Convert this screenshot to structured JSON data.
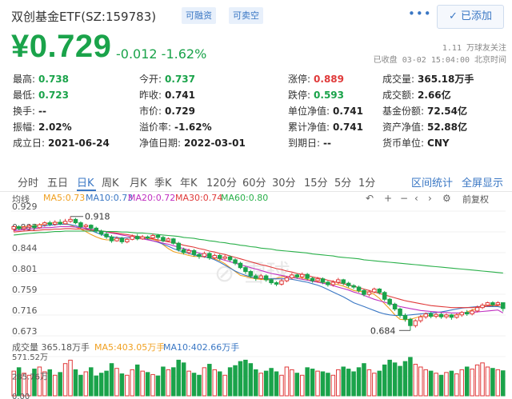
{
  "header": {
    "title": "双创基金ETF(SZ:159783)",
    "badge_margin": "可融资",
    "badge_short": "可卖空",
    "more_icon": "more-dots-icon",
    "added_label": "✓ 已添加"
  },
  "quote": {
    "price": "¥0.729",
    "change": "-0.012 -1.62%",
    "followers": "1.11 万球友关注",
    "status": "已收盘 03-02 15:04:00 北京时间"
  },
  "stats": [
    {
      "label": "最高:",
      "value": "0.738",
      "color": "#1aa34a"
    },
    {
      "label": "今开:",
      "value": "0.737",
      "color": "#1aa34a"
    },
    {
      "label": "涨停:",
      "value": "0.889",
      "color": "#e03a3a"
    },
    {
      "label": "成交量:",
      "value": "365.18万手",
      "color": "#222"
    },
    {
      "label": "最低:",
      "value": "0.723",
      "color": "#1aa34a"
    },
    {
      "label": "昨收:",
      "value": "0.741",
      "color": "#222"
    },
    {
      "label": "跌停:",
      "value": "0.593",
      "color": "#1aa34a"
    },
    {
      "label": "成交额:",
      "value": "2.66亿",
      "color": "#222"
    },
    {
      "label": "换手:",
      "value": "--",
      "color": "#222"
    },
    {
      "label": "市价:",
      "value": "0.729",
      "color": "#222"
    },
    {
      "label": "单位净值:",
      "value": "0.741",
      "color": "#222"
    },
    {
      "label": "基金份额:",
      "value": "72.54亿",
      "color": "#222"
    },
    {
      "label": "振幅:",
      "value": "2.02%",
      "color": "#222"
    },
    {
      "label": "溢价率:",
      "value": "-1.62%",
      "color": "#222"
    },
    {
      "label": "累计净值:",
      "value": "0.741",
      "color": "#222"
    },
    {
      "label": "资产净值:",
      "value": "52.88亿",
      "color": "#222"
    },
    {
      "label": "成立日:",
      "value": "2021-06-24",
      "color": "#222"
    },
    {
      "label": "净值日期:",
      "value": "2022-03-01",
      "color": "#222"
    },
    {
      "label": "到期日:",
      "value": "--",
      "color": "#222"
    },
    {
      "label": "货币单位:",
      "value": "CNY",
      "color": "#222"
    }
  ],
  "tabs": [
    "分时",
    "五日",
    "日K",
    "周K",
    "月K",
    "季K",
    "年K",
    "120分",
    "60分",
    "30分",
    "15分",
    "5分",
    "1分"
  ],
  "active_tab": "日K",
  "tab_links": [
    "区间统计",
    "全屏显示"
  ],
  "chart_controls": {
    "left_label": "均线",
    "adjust_label": "前复权",
    "icons": [
      "undo-icon",
      "zoom-in-icon",
      "zoom-out-icon",
      "move-left-icon",
      "move-right-icon",
      "settings-icon"
    ]
  },
  "ma_legend": [
    {
      "label": "MA5:0.73",
      "color": "#f0a020"
    },
    {
      "label": "MA10:0.73",
      "color": "#3a77c4"
    },
    {
      "label": "MA20:0.72",
      "color": "#c030c0"
    },
    {
      "label": "MA30:0.74",
      "color": "#e03a3a"
    },
    {
      "label": "MA60:0.80",
      "color": "#2ab04a"
    }
  ],
  "volume_legend": [
    {
      "label": "成交量 365.18万手",
      "color": "#555"
    },
    {
      "label": "MA5:403.05万手",
      "color": "#f0a020"
    },
    {
      "label": "MA10:402.66万手",
      "color": "#3a77c4"
    }
  ],
  "colors": {
    "up": "#e03a3a",
    "down": "#1aa34a",
    "accent": "#3a77c4"
  },
  "chart_data": {
    "type": "candlestick",
    "y_ticks": [
      "0.929",
      "0.887",
      "0.844",
      "0.801",
      "0.759",
      "0.716",
      "0.673"
    ],
    "ylim": [
      0.673,
      0.929
    ],
    "annotations": {
      "high": "0.918",
      "low": "0.684"
    },
    "volume_ticks": [
      "571.52万",
      "285.76万",
      "0.00"
    ],
    "volume_ylim": [
      0,
      571.52
    ],
    "candles": [
      [
        0.892,
        0.897,
        0.887,
        0.899
      ],
      [
        0.897,
        0.893,
        0.89,
        0.9
      ],
      [
        0.893,
        0.896,
        0.889,
        0.899
      ],
      [
        0.896,
        0.899,
        0.892,
        0.902
      ],
      [
        0.899,
        0.895,
        0.891,
        0.903
      ],
      [
        0.895,
        0.901,
        0.893,
        0.904
      ],
      [
        0.901,
        0.905,
        0.897,
        0.908
      ],
      [
        0.905,
        0.902,
        0.898,
        0.909
      ],
      [
        0.902,
        0.906,
        0.899,
        0.91
      ],
      [
        0.906,
        0.903,
        0.9,
        0.912
      ],
      [
        0.903,
        0.908,
        0.901,
        0.913
      ],
      [
        0.908,
        0.912,
        0.905,
        0.918
      ],
      [
        0.912,
        0.905,
        0.902,
        0.915
      ],
      [
        0.905,
        0.897,
        0.893,
        0.908
      ],
      [
        0.897,
        0.9,
        0.893,
        0.903
      ],
      [
        0.9,
        0.894,
        0.889,
        0.902
      ],
      [
        0.894,
        0.888,
        0.884,
        0.897
      ],
      [
        0.888,
        0.882,
        0.878,
        0.891
      ],
      [
        0.882,
        0.876,
        0.872,
        0.886
      ],
      [
        0.876,
        0.868,
        0.864,
        0.88
      ],
      [
        0.868,
        0.873,
        0.866,
        0.877
      ],
      [
        0.873,
        0.866,
        0.862,
        0.876
      ],
      [
        0.866,
        0.871,
        0.863,
        0.874
      ],
      [
        0.871,
        0.877,
        0.869,
        0.881
      ],
      [
        0.877,
        0.872,
        0.869,
        0.882
      ],
      [
        0.872,
        0.876,
        0.87,
        0.88
      ],
      [
        0.876,
        0.874,
        0.871,
        0.879
      ],
      [
        0.874,
        0.879,
        0.872,
        0.883
      ],
      [
        0.879,
        0.875,
        0.871,
        0.882
      ],
      [
        0.875,
        0.868,
        0.865,
        0.878
      ],
      [
        0.868,
        0.872,
        0.865,
        0.875
      ],
      [
        0.872,
        0.863,
        0.86,
        0.874
      ],
      [
        0.863,
        0.85,
        0.846,
        0.866
      ],
      [
        0.85,
        0.844,
        0.84,
        0.854
      ],
      [
        0.844,
        0.848,
        0.84,
        0.852
      ],
      [
        0.848,
        0.84,
        0.836,
        0.851
      ],
      [
        0.84,
        0.836,
        0.831,
        0.843
      ],
      [
        0.836,
        0.842,
        0.833,
        0.846
      ],
      [
        0.842,
        0.833,
        0.829,
        0.845
      ],
      [
        0.833,
        0.838,
        0.83,
        0.842
      ],
      [
        0.838,
        0.832,
        0.828,
        0.841
      ],
      [
        0.832,
        0.835,
        0.828,
        0.839
      ],
      [
        0.835,
        0.829,
        0.825,
        0.838
      ],
      [
        0.829,
        0.822,
        0.818,
        0.832
      ],
      [
        0.822,
        0.813,
        0.81,
        0.825
      ],
      [
        0.813,
        0.805,
        0.8,
        0.816
      ],
      [
        0.805,
        0.796,
        0.792,
        0.808
      ],
      [
        0.796,
        0.791,
        0.786,
        0.8
      ],
      [
        0.791,
        0.796,
        0.788,
        0.8
      ],
      [
        0.796,
        0.788,
        0.784,
        0.799
      ],
      [
        0.788,
        0.782,
        0.778,
        0.791
      ],
      [
        0.782,
        0.779,
        0.775,
        0.785
      ],
      [
        0.779,
        0.786,
        0.776,
        0.79
      ],
      [
        0.786,
        0.792,
        0.783,
        0.796
      ],
      [
        0.792,
        0.798,
        0.789,
        0.802
      ],
      [
        0.798,
        0.794,
        0.79,
        0.801
      ],
      [
        0.794,
        0.799,
        0.79,
        0.803
      ],
      [
        0.799,
        0.791,
        0.787,
        0.802
      ],
      [
        0.791,
        0.786,
        0.782,
        0.794
      ],
      [
        0.786,
        0.79,
        0.782,
        0.794
      ],
      [
        0.79,
        0.783,
        0.779,
        0.793
      ],
      [
        0.783,
        0.778,
        0.774,
        0.786
      ],
      [
        0.778,
        0.783,
        0.774,
        0.787
      ],
      [
        0.783,
        0.788,
        0.779,
        0.792
      ],
      [
        0.788,
        0.781,
        0.777,
        0.79
      ],
      [
        0.781,
        0.776,
        0.772,
        0.784
      ],
      [
        0.776,
        0.773,
        0.769,
        0.779
      ],
      [
        0.773,
        0.766,
        0.762,
        0.776
      ],
      [
        0.766,
        0.758,
        0.754,
        0.769
      ],
      [
        0.758,
        0.763,
        0.754,
        0.767
      ],
      [
        0.763,
        0.769,
        0.76,
        0.772
      ],
      [
        0.769,
        0.762,
        0.758,
        0.771
      ],
      [
        0.762,
        0.748,
        0.744,
        0.765
      ],
      [
        0.748,
        0.738,
        0.734,
        0.751
      ],
      [
        0.738,
        0.728,
        0.724,
        0.741
      ],
      [
        0.728,
        0.715,
        0.71,
        0.731
      ],
      [
        0.715,
        0.707,
        0.702,
        0.719
      ],
      [
        0.707,
        0.694,
        0.684,
        0.71
      ],
      [
        0.694,
        0.704,
        0.69,
        0.707
      ],
      [
        0.704,
        0.712,
        0.7,
        0.716
      ],
      [
        0.712,
        0.718,
        0.708,
        0.721
      ],
      [
        0.718,
        0.713,
        0.709,
        0.722
      ],
      [
        0.713,
        0.717,
        0.709,
        0.72
      ],
      [
        0.717,
        0.712,
        0.708,
        0.72
      ],
      [
        0.712,
        0.716,
        0.708,
        0.719
      ],
      [
        0.716,
        0.711,
        0.706,
        0.718
      ],
      [
        0.711,
        0.716,
        0.708,
        0.719
      ],
      [
        0.716,
        0.721,
        0.712,
        0.724
      ],
      [
        0.721,
        0.718,
        0.714,
        0.726
      ],
      [
        0.718,
        0.724,
        0.715,
        0.728
      ],
      [
        0.724,
        0.731,
        0.721,
        0.735
      ],
      [
        0.731,
        0.736,
        0.728,
        0.74
      ],
      [
        0.736,
        0.741,
        0.733,
        0.743
      ],
      [
        0.741,
        0.737,
        0.733,
        0.744
      ],
      [
        0.737,
        0.741,
        0.734,
        0.744
      ],
      [
        0.741,
        0.729,
        0.723,
        0.738
      ]
    ],
    "volumes": [
      360,
      410,
      330,
      300,
      390,
      420,
      350,
      380,
      300,
      340,
      470,
      520,
      380,
      300,
      350,
      410,
      290,
      330,
      360,
      470,
      400,
      320,
      300,
      380,
      450,
      360,
      340,
      310,
      290,
      420,
      380,
      410,
      520,
      480,
      360,
      330,
      300,
      410,
      460,
      380,
      350,
      300,
      410,
      440,
      500,
      520,
      470,
      380,
      330,
      360,
      400,
      350,
      300,
      420,
      380,
      330,
      300,
      410,
      390,
      360,
      350,
      330,
      300,
      380,
      420,
      390,
      350,
      410,
      470,
      380,
      330,
      360,
      450,
      520,
      480,
      430,
      500,
      560,
      460,
      420,
      380,
      360,
      330,
      300,
      340,
      360,
      320,
      380,
      420,
      390,
      450,
      480,
      420,
      400,
      380,
      365
    ],
    "ma": {
      "MA5": [
        0.895,
        0.896,
        0.897,
        0.898,
        0.899,
        0.901,
        0.903,
        0.904,
        0.905,
        0.906,
        0.905,
        0.9,
        0.896,
        0.892,
        0.887,
        0.881,
        0.876,
        0.872,
        0.87,
        0.87,
        0.871,
        0.873,
        0.874,
        0.875,
        0.876,
        0.875,
        0.873,
        0.871,
        0.868,
        0.86,
        0.852,
        0.846,
        0.843,
        0.841,
        0.838,
        0.836,
        0.836,
        0.835,
        0.833,
        0.831,
        0.827,
        0.821,
        0.813,
        0.805,
        0.797,
        0.795,
        0.792,
        0.79,
        0.789,
        0.788,
        0.789,
        0.791,
        0.794,
        0.795,
        0.795,
        0.794,
        0.792,
        0.789,
        0.786,
        0.784,
        0.783,
        0.781,
        0.78,
        0.778,
        0.775,
        0.771,
        0.766,
        0.764,
        0.764,
        0.763,
        0.758,
        0.75,
        0.739,
        0.728,
        0.716,
        0.707,
        0.706,
        0.707,
        0.71,
        0.713,
        0.715,
        0.714,
        0.714,
        0.714,
        0.714,
        0.715,
        0.716,
        0.719,
        0.722,
        0.726,
        0.73,
        0.734,
        0.737,
        0.736,
        0.734,
        0.731
      ],
      "MA10": [
        0.893,
        0.894,
        0.895,
        0.896,
        0.897,
        0.898,
        0.899,
        0.9,
        0.901,
        0.902,
        0.902,
        0.901,
        0.899,
        0.896,
        0.893,
        0.889,
        0.885,
        0.881,
        0.878,
        0.876,
        0.875,
        0.874,
        0.874,
        0.874,
        0.874,
        0.873,
        0.871,
        0.868,
        0.865,
        0.861,
        0.857,
        0.852,
        0.848,
        0.845,
        0.842,
        0.839,
        0.837,
        0.835,
        0.833,
        0.829,
        0.824,
        0.818,
        0.812,
        0.806,
        0.801,
        0.797,
        0.794,
        0.792,
        0.791,
        0.79,
        0.79,
        0.79,
        0.79,
        0.79,
        0.789,
        0.787,
        0.785,
        0.783,
        0.78,
        0.777,
        0.773,
        0.768,
        0.763,
        0.758,
        0.753,
        0.747,
        0.741,
        0.737,
        0.733,
        0.729,
        0.725,
        0.721,
        0.718,
        0.716,
        0.715,
        0.715,
        0.715,
        0.716,
        0.717,
        0.718,
        0.719,
        0.72,
        0.721,
        0.722,
        0.724,
        0.726,
        0.728,
        0.73,
        0.731,
        0.732,
        0.733,
        0.733,
        0.733,
        0.733,
        0.733,
        0.731
      ],
      "MA20": [
        0.889,
        0.89,
        0.891,
        0.892,
        0.893,
        0.894,
        0.895,
        0.895,
        0.896,
        0.897,
        0.897,
        0.897,
        0.896,
        0.895,
        0.894,
        0.892,
        0.89,
        0.888,
        0.886,
        0.884,
        0.882,
        0.88,
        0.878,
        0.876,
        0.874,
        0.872,
        0.87,
        0.868,
        0.866,
        0.863,
        0.861,
        0.858,
        0.855,
        0.852,
        0.849,
        0.846,
        0.843,
        0.84,
        0.837,
        0.834,
        0.831,
        0.828,
        0.825,
        0.822,
        0.819,
        0.816,
        0.813,
        0.81,
        0.807,
        0.804,
        0.801,
        0.799,
        0.797,
        0.795,
        0.793,
        0.791,
        0.789,
        0.787,
        0.785,
        0.783,
        0.781,
        0.779,
        0.776,
        0.773,
        0.77,
        0.767,
        0.763,
        0.76,
        0.756,
        0.752,
        0.748,
        0.745,
        0.742,
        0.739,
        0.736,
        0.733,
        0.731,
        0.729,
        0.727,
        0.725,
        0.724,
        0.723,
        0.722,
        0.721,
        0.721,
        0.72,
        0.72,
        0.72,
        0.721,
        0.721,
        0.722,
        0.723,
        0.724,
        0.725,
        0.726,
        0.72
      ],
      "MA30": [
        0.886,
        0.887,
        0.888,
        0.889,
        0.889,
        0.89,
        0.891,
        0.891,
        0.892,
        0.892,
        0.893,
        0.893,
        0.892,
        0.892,
        0.891,
        0.89,
        0.889,
        0.888,
        0.887,
        0.885,
        0.884,
        0.882,
        0.881,
        0.879,
        0.877,
        0.876,
        0.874,
        0.872,
        0.87,
        0.868,
        0.866,
        0.864,
        0.862,
        0.859,
        0.857,
        0.855,
        0.852,
        0.85,
        0.847,
        0.845,
        0.842,
        0.84,
        0.837,
        0.834,
        0.831,
        0.828,
        0.825,
        0.822,
        0.819,
        0.817,
        0.814,
        0.811,
        0.809,
        0.806,
        0.804,
        0.801,
        0.799,
        0.797,
        0.794,
        0.792,
        0.79,
        0.787,
        0.785,
        0.782,
        0.78,
        0.777,
        0.775,
        0.772,
        0.769,
        0.766,
        0.763,
        0.76,
        0.757,
        0.754,
        0.751,
        0.748,
        0.745,
        0.743,
        0.741,
        0.739,
        0.737,
        0.735,
        0.734,
        0.733,
        0.732,
        0.731,
        0.731,
        0.731,
        0.731,
        0.731,
        0.732,
        0.733,
        0.734,
        0.735,
        0.736,
        0.737
      ],
      "MA60": [
        0.88,
        0.881,
        0.882,
        0.883,
        0.884,
        0.885,
        0.885,
        0.886,
        0.887,
        0.887,
        0.888,
        0.888,
        0.888,
        0.888,
        0.888,
        0.888,
        0.888,
        0.888,
        0.887,
        0.887,
        0.887,
        0.886,
        0.886,
        0.885,
        0.884,
        0.884,
        0.883,
        0.882,
        0.881,
        0.88,
        0.879,
        0.878,
        0.877,
        0.875,
        0.874,
        0.873,
        0.871,
        0.87,
        0.868,
        0.867,
        0.865,
        0.864,
        0.862,
        0.861,
        0.859,
        0.858,
        0.856,
        0.855,
        0.853,
        0.852,
        0.851,
        0.849,
        0.848,
        0.847,
        0.846,
        0.845,
        0.844,
        0.843,
        0.841,
        0.84,
        0.839,
        0.838,
        0.837,
        0.835,
        0.834,
        0.833,
        0.832,
        0.831,
        0.829,
        0.828,
        0.827,
        0.826,
        0.825,
        0.824,
        0.823,
        0.822,
        0.821,
        0.82,
        0.819,
        0.818,
        0.817,
        0.816,
        0.815,
        0.814,
        0.813,
        0.812,
        0.811,
        0.81,
        0.809,
        0.808,
        0.807,
        0.806,
        0.805,
        0.804,
        0.803,
        0.802
      ]
    }
  }
}
